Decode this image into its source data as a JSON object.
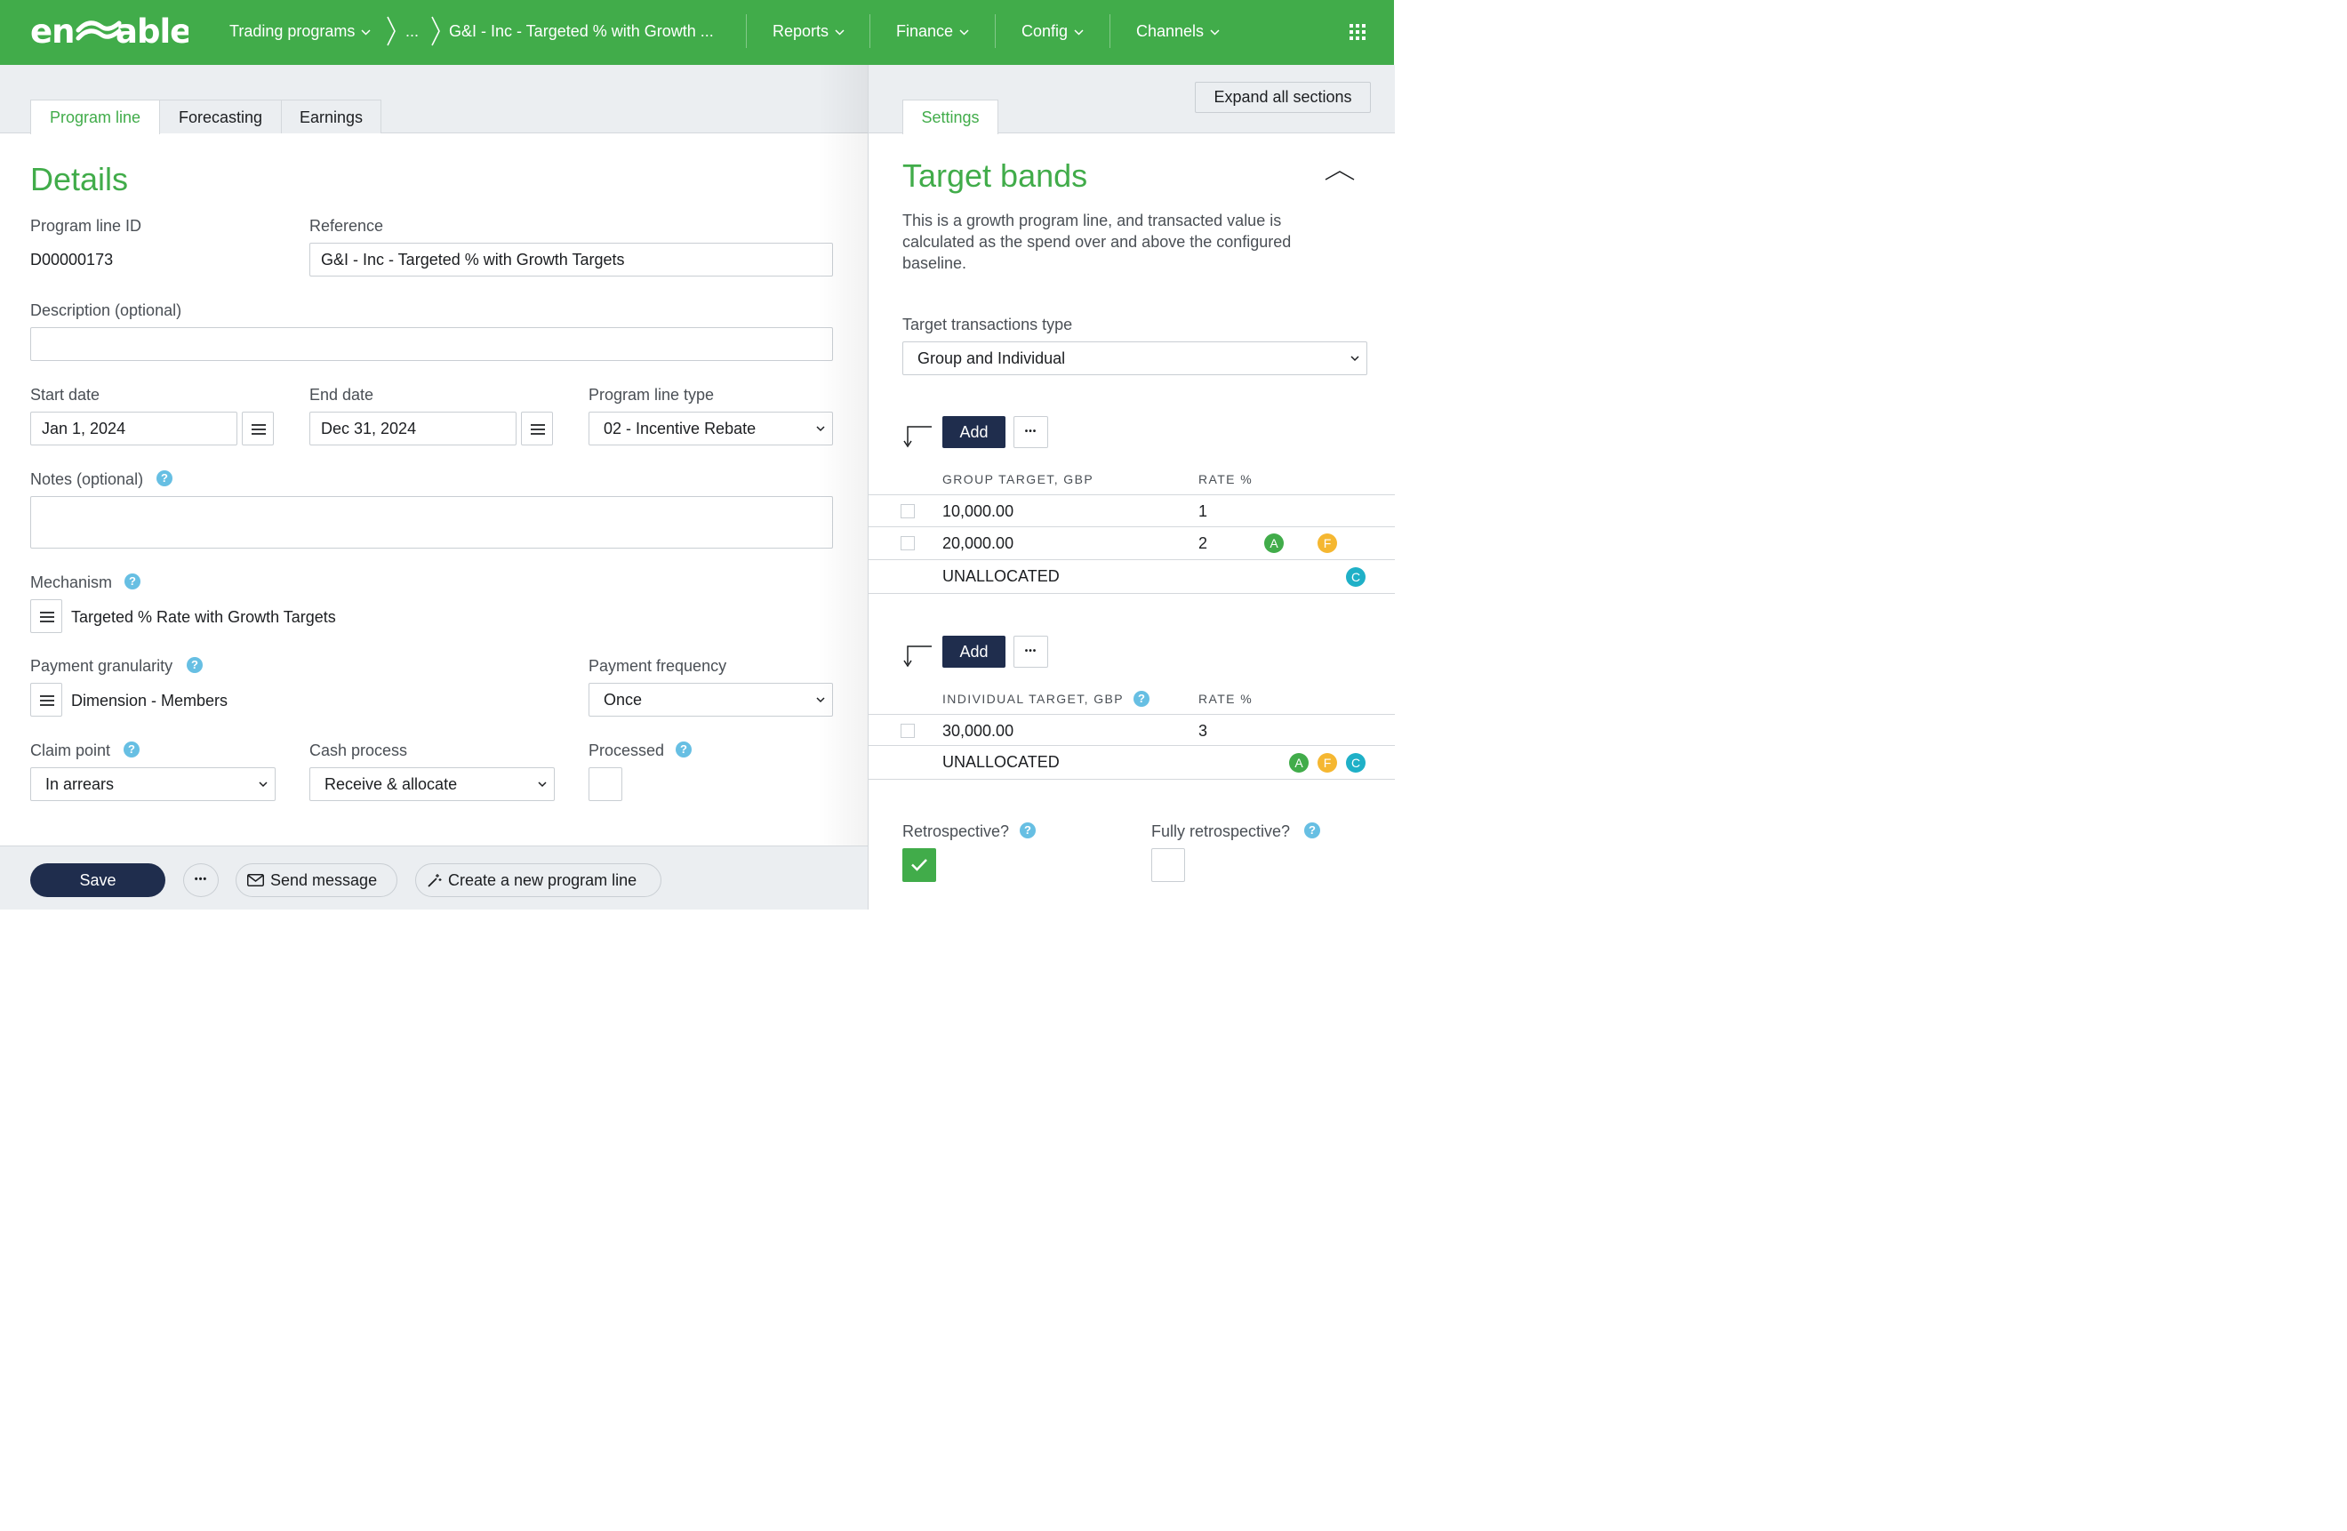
{
  "app": {
    "brand": "enable",
    "accent": "#41ac4a",
    "navy": "#1f2d4d"
  },
  "nav": {
    "trading_programs": "Trading programs",
    "ellipsis": "...",
    "current": "G&I - Inc - Targeted % with Growth ...",
    "reports": "Reports",
    "finance": "Finance",
    "config": "Config",
    "channels": "Channels",
    "apps_icon": "grid-icon"
  },
  "tabs": {
    "program_line": "Program line",
    "forecasting": "Forecasting",
    "earnings": "Earnings"
  },
  "details": {
    "title": "Details",
    "program_line_id_label": "Program line ID",
    "program_line_id": "D00000173",
    "reference_label": "Reference",
    "reference": "G&I - Inc - Targeted % with Growth Targets",
    "description_label": "Description (optional)",
    "description": "",
    "start_date_label": "Start date",
    "start_date": "Jan 1, 2024",
    "end_date_label": "End date",
    "end_date": "Dec 31, 2024",
    "program_line_type_label": "Program line type",
    "program_line_type": "02 - Incentive Rebate",
    "notes_label": "Notes (optional)",
    "notes": "",
    "mechanism_label": "Mechanism",
    "mechanism": "Targeted % Rate with Growth Targets",
    "payment_granularity_label": "Payment granularity",
    "payment_granularity": "Dimension - Members",
    "payment_frequency_label": "Payment frequency",
    "payment_frequency": "Once",
    "claim_point_label": "Claim point",
    "claim_point": "In arrears",
    "cash_process_label": "Cash process",
    "cash_process": "Receive & allocate",
    "processed_label": "Processed",
    "processed": false
  },
  "footer": {
    "save": "Save",
    "more": "•••",
    "send_message": "Send message",
    "create_new": "Create a new program line"
  },
  "right": {
    "expand_all": "Expand all sections",
    "settings_tab": "Settings",
    "title": "Target bands",
    "description": "This is a growth program line, and transacted value is calculated as the spend over and above the configured baseline.",
    "target_transactions_type_label": "Target transactions type",
    "target_transactions_type": "Group and Individual",
    "add": "Add",
    "more": "•••",
    "group": {
      "col_target": "GROUP TARGET, GBP",
      "col_rate": "RATE %",
      "rows": [
        {
          "target": "10,000.00",
          "rate": "1"
        },
        {
          "target": "20,000.00",
          "rate": "2",
          "badges": [
            "A",
            "F"
          ]
        }
      ],
      "unallocated": "UNALLOCATED",
      "unallocated_badges": [
        "C"
      ]
    },
    "individual": {
      "col_target": "INDIVIDUAL TARGET, GBP",
      "col_rate": "RATE %",
      "rows": [
        {
          "target": "30,000.00",
          "rate": "3"
        }
      ],
      "unallocated": "UNALLOCATED",
      "unallocated_badges": [
        "A",
        "F",
        "C"
      ]
    },
    "badge_colors": {
      "A": "#41ac4a",
      "F": "#f5b731",
      "C": "#1fb0c7"
    },
    "retrospective_label": "Retrospective?",
    "retrospective": true,
    "fully_retrospective_label": "Fully retrospective?",
    "fully_retrospective": false
  }
}
